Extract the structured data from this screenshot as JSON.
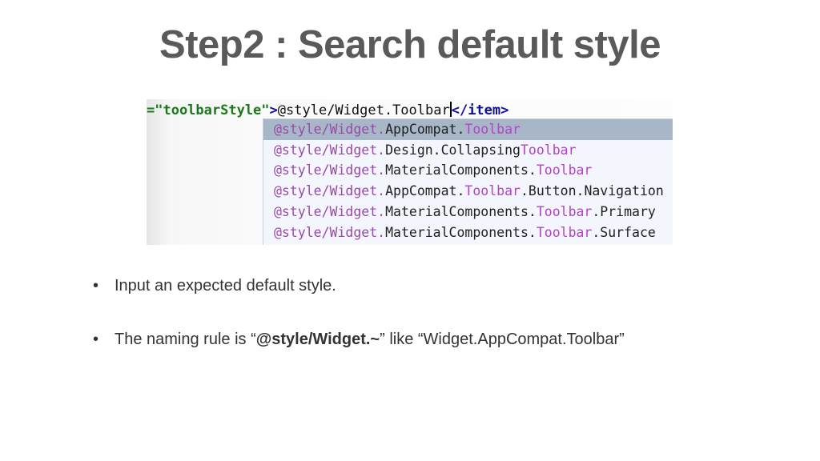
{
  "slide": {
    "title": "Step2 : Search default style"
  },
  "editor": {
    "code": {
      "attr_value": "=\"toolbarStyle\"",
      "tag_close": ">",
      "text_before_caret": "@style/Widget.Toolbar",
      "closing_tag": "</item>"
    },
    "autocomplete": {
      "selected_index": 0,
      "colors": {
        "prefix": "#9a4aa8",
        "match": "#b542c8",
        "selection": "#a7b7c8",
        "background": "#f3f6fc"
      },
      "items": [
        {
          "prefix": "@style/Widget.",
          "middle": "AppCompat.",
          "match": "Toolbar",
          "suffix": ""
        },
        {
          "prefix": "@style/Widget.",
          "middle": "Design.Collapsing",
          "match": "Toolbar",
          "suffix": ""
        },
        {
          "prefix": "@style/Widget.",
          "middle": "MaterialComponents.",
          "match": "Toolbar",
          "suffix": ""
        },
        {
          "prefix": "@style/Widget.",
          "middle": "AppCompat.",
          "match": "Toolbar",
          "suffix": ".Button.Navigation"
        },
        {
          "prefix": "@style/Widget.",
          "middle": "MaterialComponents.",
          "match": "Toolbar",
          "suffix": ".Primary"
        },
        {
          "prefix": "@style/Widget.",
          "middle": "MaterialComponents.",
          "match": "Toolbar",
          "suffix": ".Surface"
        }
      ]
    }
  },
  "bullets": [
    {
      "dot": "•",
      "text": "Input an expected default style."
    },
    {
      "dot": "•",
      "pre": "The naming rule is “",
      "bold": "@style/Widget.~",
      "post": "” like “Widget.AppCompat.Toolbar”"
    }
  ]
}
